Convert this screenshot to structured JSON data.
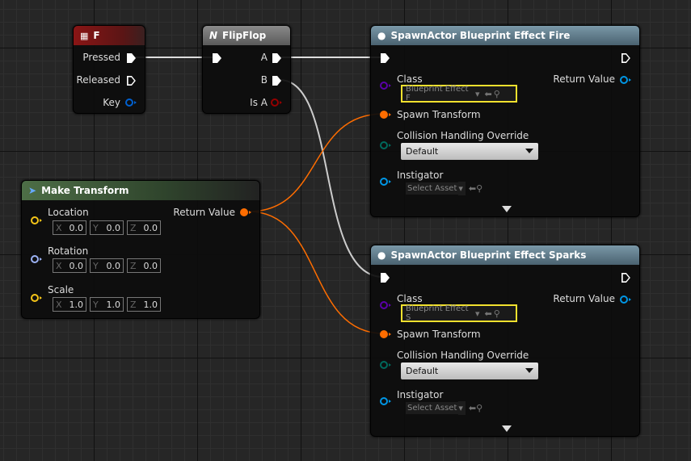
{
  "colors": {
    "exec": "#ffffff",
    "object": "#0097e6",
    "class": "#5a00a8",
    "transform": "#ff6d00",
    "vector": "#f5c518",
    "rotator": "#9cb2f5",
    "enum": "#00695c",
    "bool": "#950000",
    "key_header": "#8a1515",
    "flipflop_header": "#6e6e6e",
    "spawn_header": "#5f7a8a",
    "make_transform_header": "#3f5c3a",
    "selected_outline": "#f2e12e"
  },
  "key_node": {
    "title": "F",
    "icon": "keyboard-icon",
    "pins": [
      "Pressed",
      "Released",
      "Key"
    ]
  },
  "flipflop_node": {
    "title": "FlipFlop",
    "icon": "flipflop-icon",
    "pins": [
      "A",
      "B",
      "Is A"
    ]
  },
  "make_transform": {
    "title": "Make Transform",
    "icon": "function-icon",
    "return_label": "Return Value",
    "location": {
      "label": "Location",
      "x": "0.0",
      "y": "0.0",
      "z": "0.0"
    },
    "rotation": {
      "label": "Rotation",
      "x": "0.0",
      "y": "0.0",
      "z": "0.0"
    },
    "scale": {
      "label": "Scale",
      "x": "1.0",
      "y": "1.0",
      "z": "1.0"
    },
    "axis_labels": [
      "X",
      "Y",
      "Z"
    ]
  },
  "spawn_nodes": [
    {
      "title": "SpawnActor Blueprint Effect Fire",
      "class_label": "Class",
      "class_value": "Blueprint Effect F",
      "return_label": "Return Value",
      "spawn_transform": "Spawn Transform",
      "collision_label": "Collision Handling Override",
      "collision_value": "Default",
      "instigator_label": "Instigator",
      "instigator_value": "Select Asset"
    },
    {
      "title": "SpawnActor Blueprint Effect Sparks",
      "class_label": "Class",
      "class_value": "Blueprint Effect S",
      "return_label": "Return Value",
      "spawn_transform": "Spawn Transform",
      "collision_label": "Collision Handling Override",
      "collision_value": "Default",
      "instigator_label": "Instigator",
      "instigator_value": "Select Asset"
    }
  ]
}
